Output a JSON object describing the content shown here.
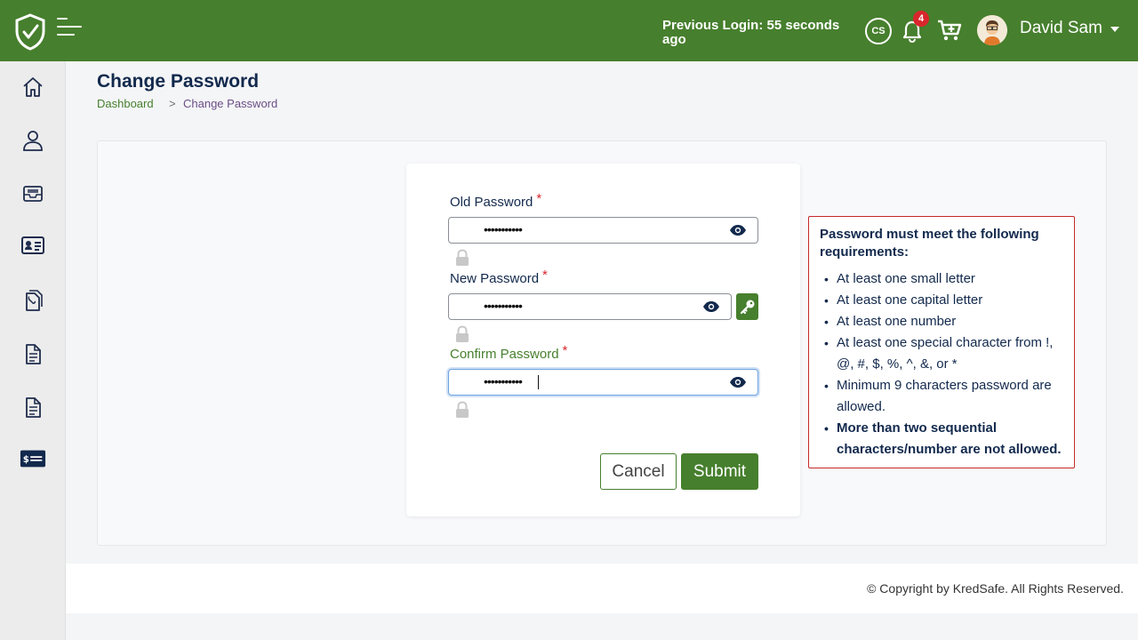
{
  "header": {
    "previous_login": "Previous Login: 55 seconds ago",
    "cs_label": "CS",
    "notification_count": "4",
    "user_name": "David Sam"
  },
  "sidebar": {
    "items": [
      {
        "icon": "home-icon"
      },
      {
        "icon": "user-icon"
      },
      {
        "icon": "inbox-icon"
      },
      {
        "icon": "id-card-icon"
      },
      {
        "icon": "documents-icon"
      },
      {
        "icon": "file-icon"
      },
      {
        "icon": "file-text-icon"
      },
      {
        "icon": "payment-card-icon"
      }
    ]
  },
  "page": {
    "title": "Change Password",
    "breadcrumb": {
      "home": "Dashboard",
      "separator": ">",
      "current": "Change Password"
    }
  },
  "form": {
    "old_password": {
      "label": "Old Password",
      "required": "*",
      "value": "•••••••••••"
    },
    "new_password": {
      "label": "New Password",
      "required": "*",
      "value": "•••••••••••"
    },
    "confirm_password": {
      "label": "Confirm Password",
      "required": "*",
      "value": "•••••••••••"
    },
    "cancel_label": "Cancel",
    "submit_label": "Submit"
  },
  "requirements": {
    "title": "Password must meet the following requirements:",
    "items": [
      "At least one small letter",
      "At least one capital letter",
      "At least one number",
      "At least one special character from !, @, #, $, %, ^, &, or *",
      "Minimum 9 characters password are allowed.",
      "More than two sequential characters/number are not allowed."
    ]
  },
  "footer": {
    "copyright": "© Copyright by KredSafe. All Rights Reserved."
  },
  "colors": {
    "brand_green": "#467f2d",
    "navy": "#12294d",
    "error_red": "#c62828"
  }
}
